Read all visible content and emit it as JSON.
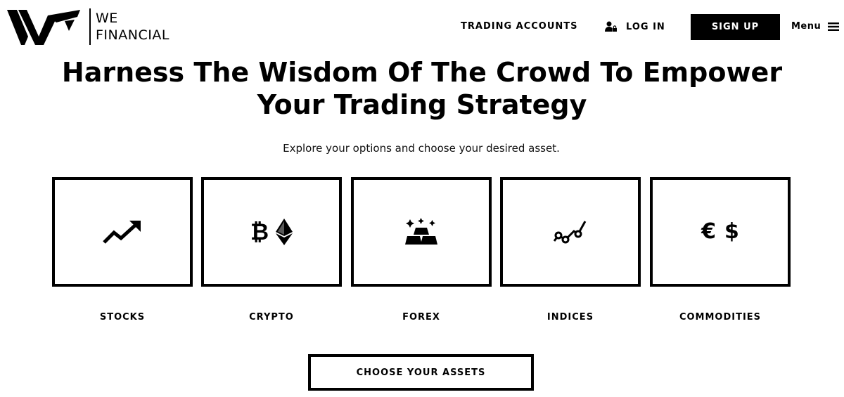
{
  "brand": {
    "logo_line1": "WE",
    "logo_line2": "FINANCIAL"
  },
  "nav": {
    "trading_accounts": "TRADING ACCOUNTS",
    "login": "LOG IN",
    "signup": "SIGN UP",
    "menu": "Menu"
  },
  "hero": {
    "title_line1": "Harness The Wisdom Of The Crowd To Empower",
    "title_line2": "Your Trading Strategy",
    "subtitle": "Explore your options and choose your desired asset."
  },
  "assets": [
    {
      "label": "STOCKS",
      "icon": "trending-up-icon"
    },
    {
      "label": "CRYPTO",
      "icon": "bitcoin-ethereum-icon",
      "glyph": "₿"
    },
    {
      "label": "FOREX",
      "icon": "gold-bars-icon"
    },
    {
      "label": "INDICES",
      "icon": "line-chart-icon"
    },
    {
      "label": "COMMODITIES",
      "icon": "euro-dollar-icon",
      "glyph_a": "€",
      "glyph_b": "$"
    }
  ],
  "cta": {
    "label": "CHOOSE YOUR ASSETS"
  },
  "colors": {
    "primary": "#000000",
    "background": "#ffffff",
    "button_text": "#ffffff"
  }
}
